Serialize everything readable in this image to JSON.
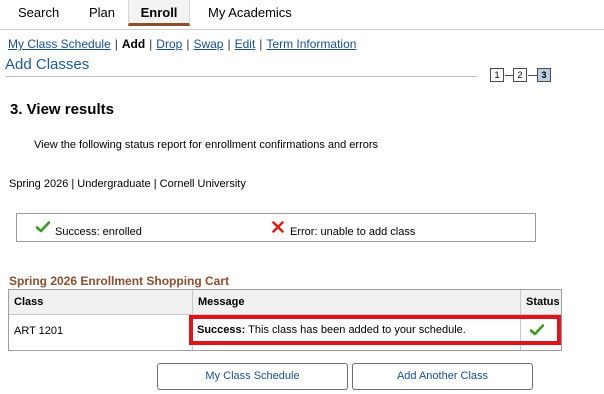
{
  "top_tabs": [
    {
      "label": "Search"
    },
    {
      "label": "Plan"
    },
    {
      "label": "Enroll"
    },
    {
      "label": "My Academics"
    }
  ],
  "subnav": {
    "my_class_schedule": "My Class Schedule",
    "add": "Add",
    "drop": "Drop",
    "swap": "Swap",
    "edit": "Edit",
    "term_information": "Term Information",
    "separator": "|"
  },
  "page_title": "Add Classes",
  "steps": [
    "1",
    "2",
    "3"
  ],
  "current_step": "3",
  "section_heading": "3.  View results",
  "instructions": "View the following status report for enrollment confirmations and errors",
  "term_line": "Spring 2026 | Undergraduate | Cornell University",
  "legend": {
    "success_text": "Success: enrolled",
    "error_text": "Error: unable to add class",
    "success_icon": "check-icon",
    "error_icon": "x-icon"
  },
  "cart": {
    "title": "Spring 2026 Enrollment Shopping Cart",
    "headers": {
      "class": "Class",
      "message": "Message",
      "status": "Status"
    },
    "rows": [
      {
        "class": "ART 1201",
        "message_prefix": "Success:",
        "message_text": " This class has been added to your schedule.",
        "status_icon": "check-icon"
      }
    ]
  },
  "buttons": {
    "my_class_schedule": "My Class Schedule",
    "add_another_class": "Add Another Class"
  },
  "colors": {
    "link": "#1a4f8f",
    "accent_brown": "#8a4d2d",
    "success_green": "#3a9b1f",
    "error_red": "#d62316",
    "highlight_red": "#e1141c"
  }
}
